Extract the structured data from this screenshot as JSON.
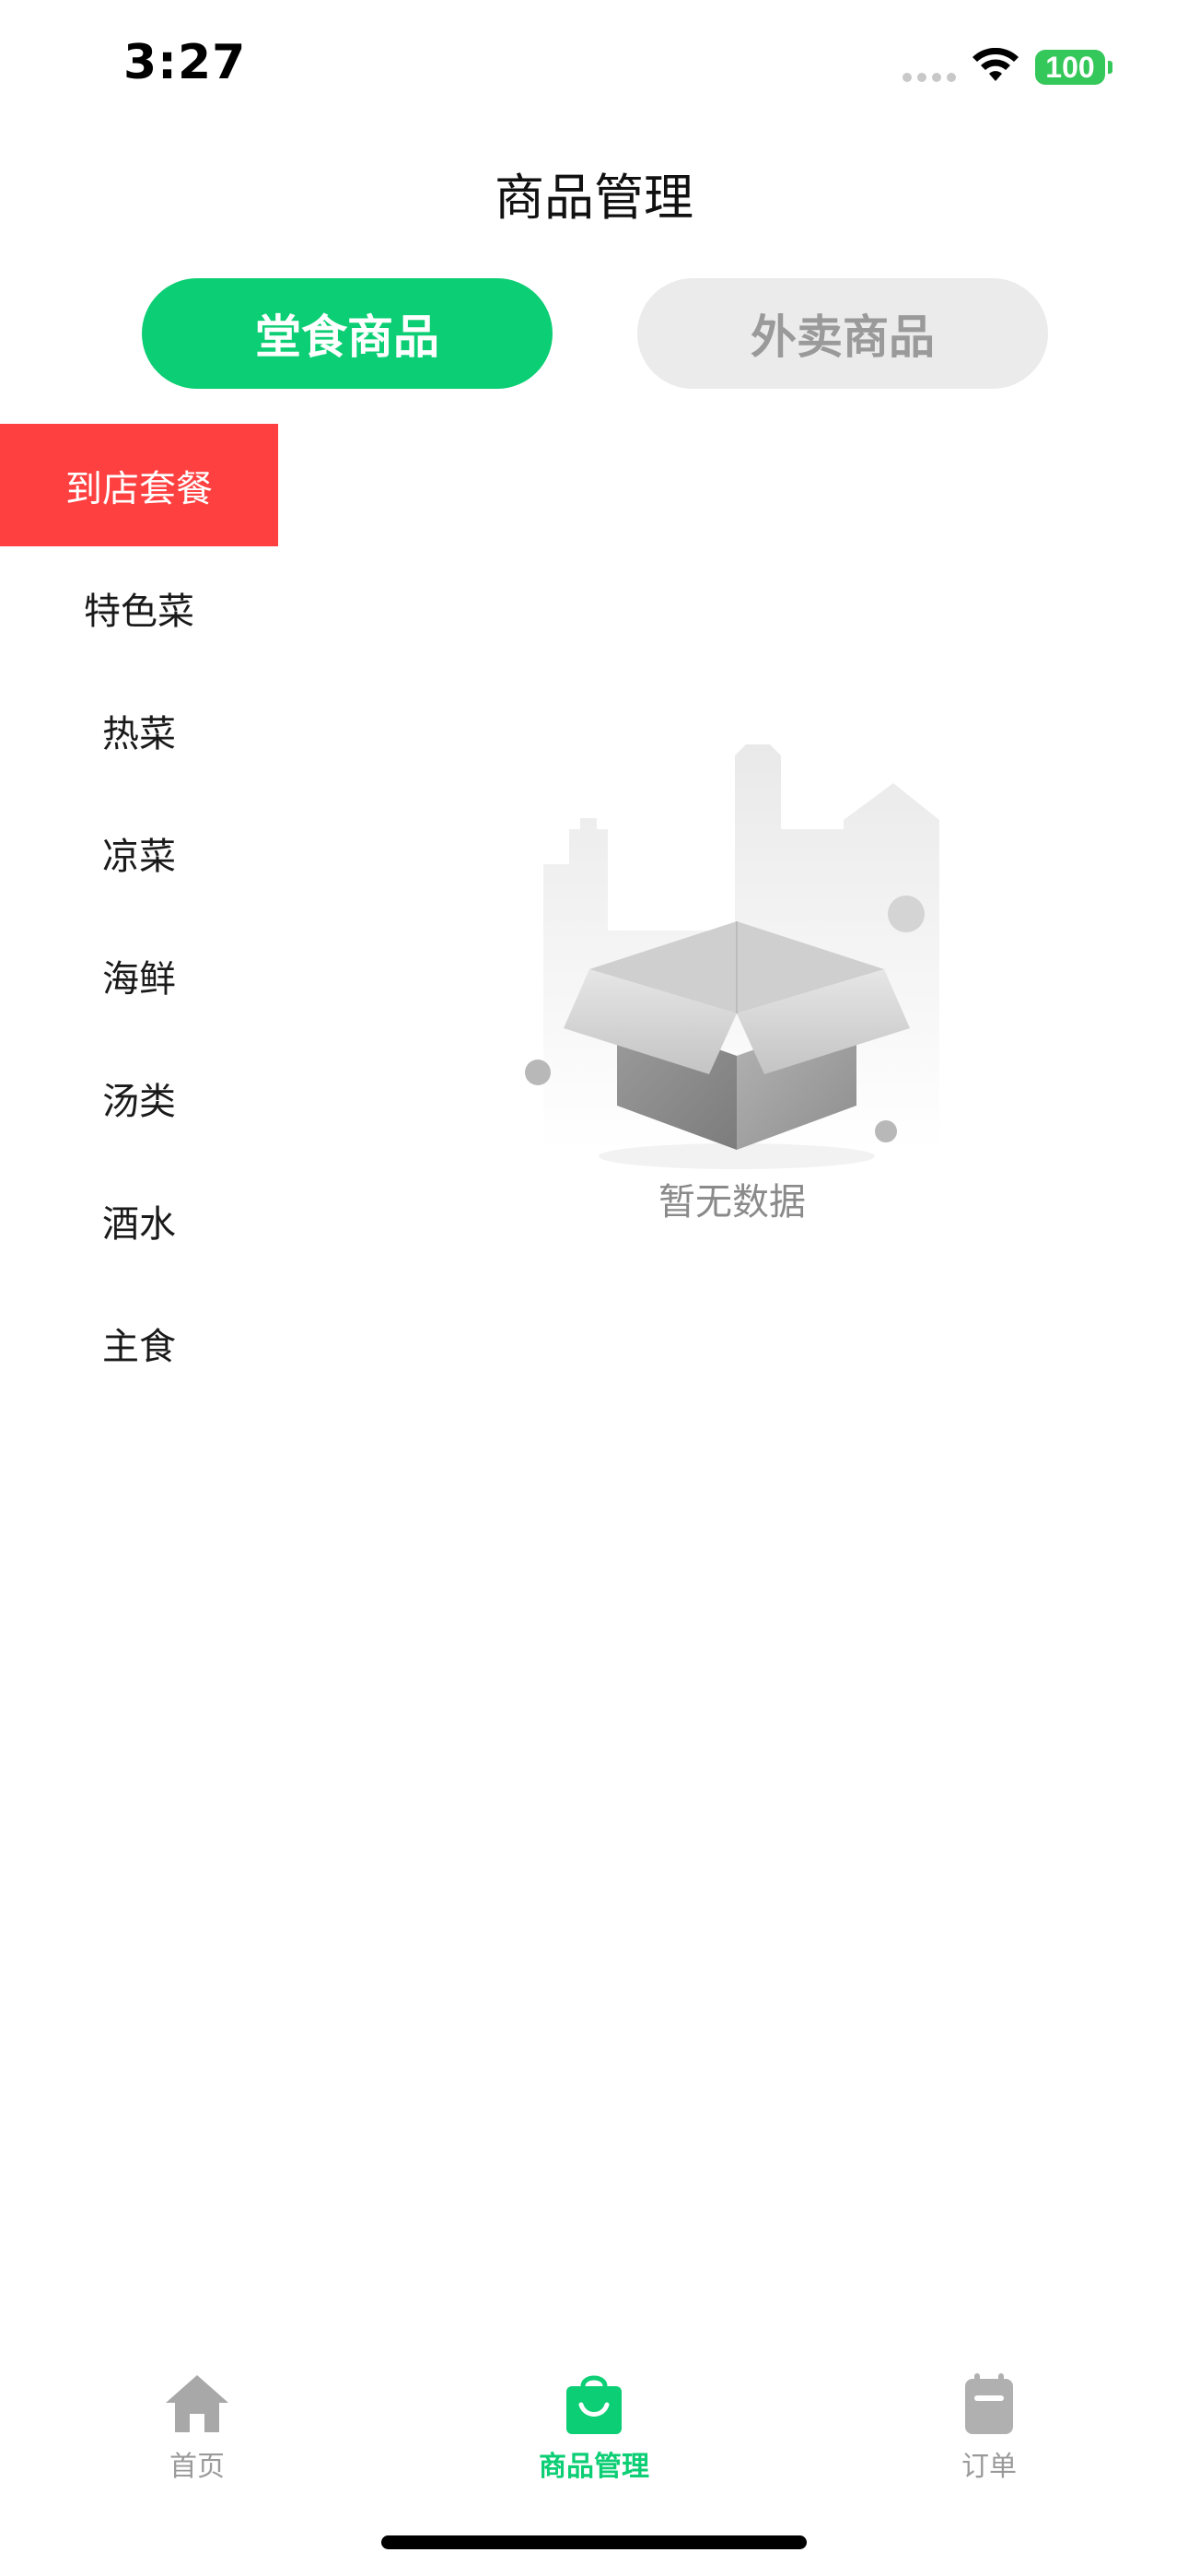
{
  "status_bar": {
    "time": "3:27",
    "battery": "100"
  },
  "header": {
    "title": "商品管理"
  },
  "segments": {
    "active_label": "堂食商品",
    "inactive_label": "外卖商品"
  },
  "categories": [
    {
      "label": "到店套餐",
      "selected": true
    },
    {
      "label": "特色菜",
      "selected": false
    },
    {
      "label": "热菜",
      "selected": false
    },
    {
      "label": "凉菜",
      "selected": false
    },
    {
      "label": "海鲜",
      "selected": false
    },
    {
      "label": "汤类",
      "selected": false
    },
    {
      "label": "酒水",
      "selected": false
    },
    {
      "label": "主食",
      "selected": false
    }
  ],
  "empty_state": {
    "text": "暂无数据",
    "icon": "empty-box-icon"
  },
  "tab_bar": {
    "items": [
      {
        "label": "首页",
        "icon": "home-icon",
        "active": false
      },
      {
        "label": "商品管理",
        "icon": "shopping-bag-icon",
        "active": true
      },
      {
        "label": "订单",
        "icon": "clipboard-icon",
        "active": false
      }
    ]
  },
  "colors": {
    "accent_green": "#0cce74",
    "selected_red": "#ff4040",
    "inactive_gray": "#9a9a9a",
    "battery_green": "#34c759"
  }
}
